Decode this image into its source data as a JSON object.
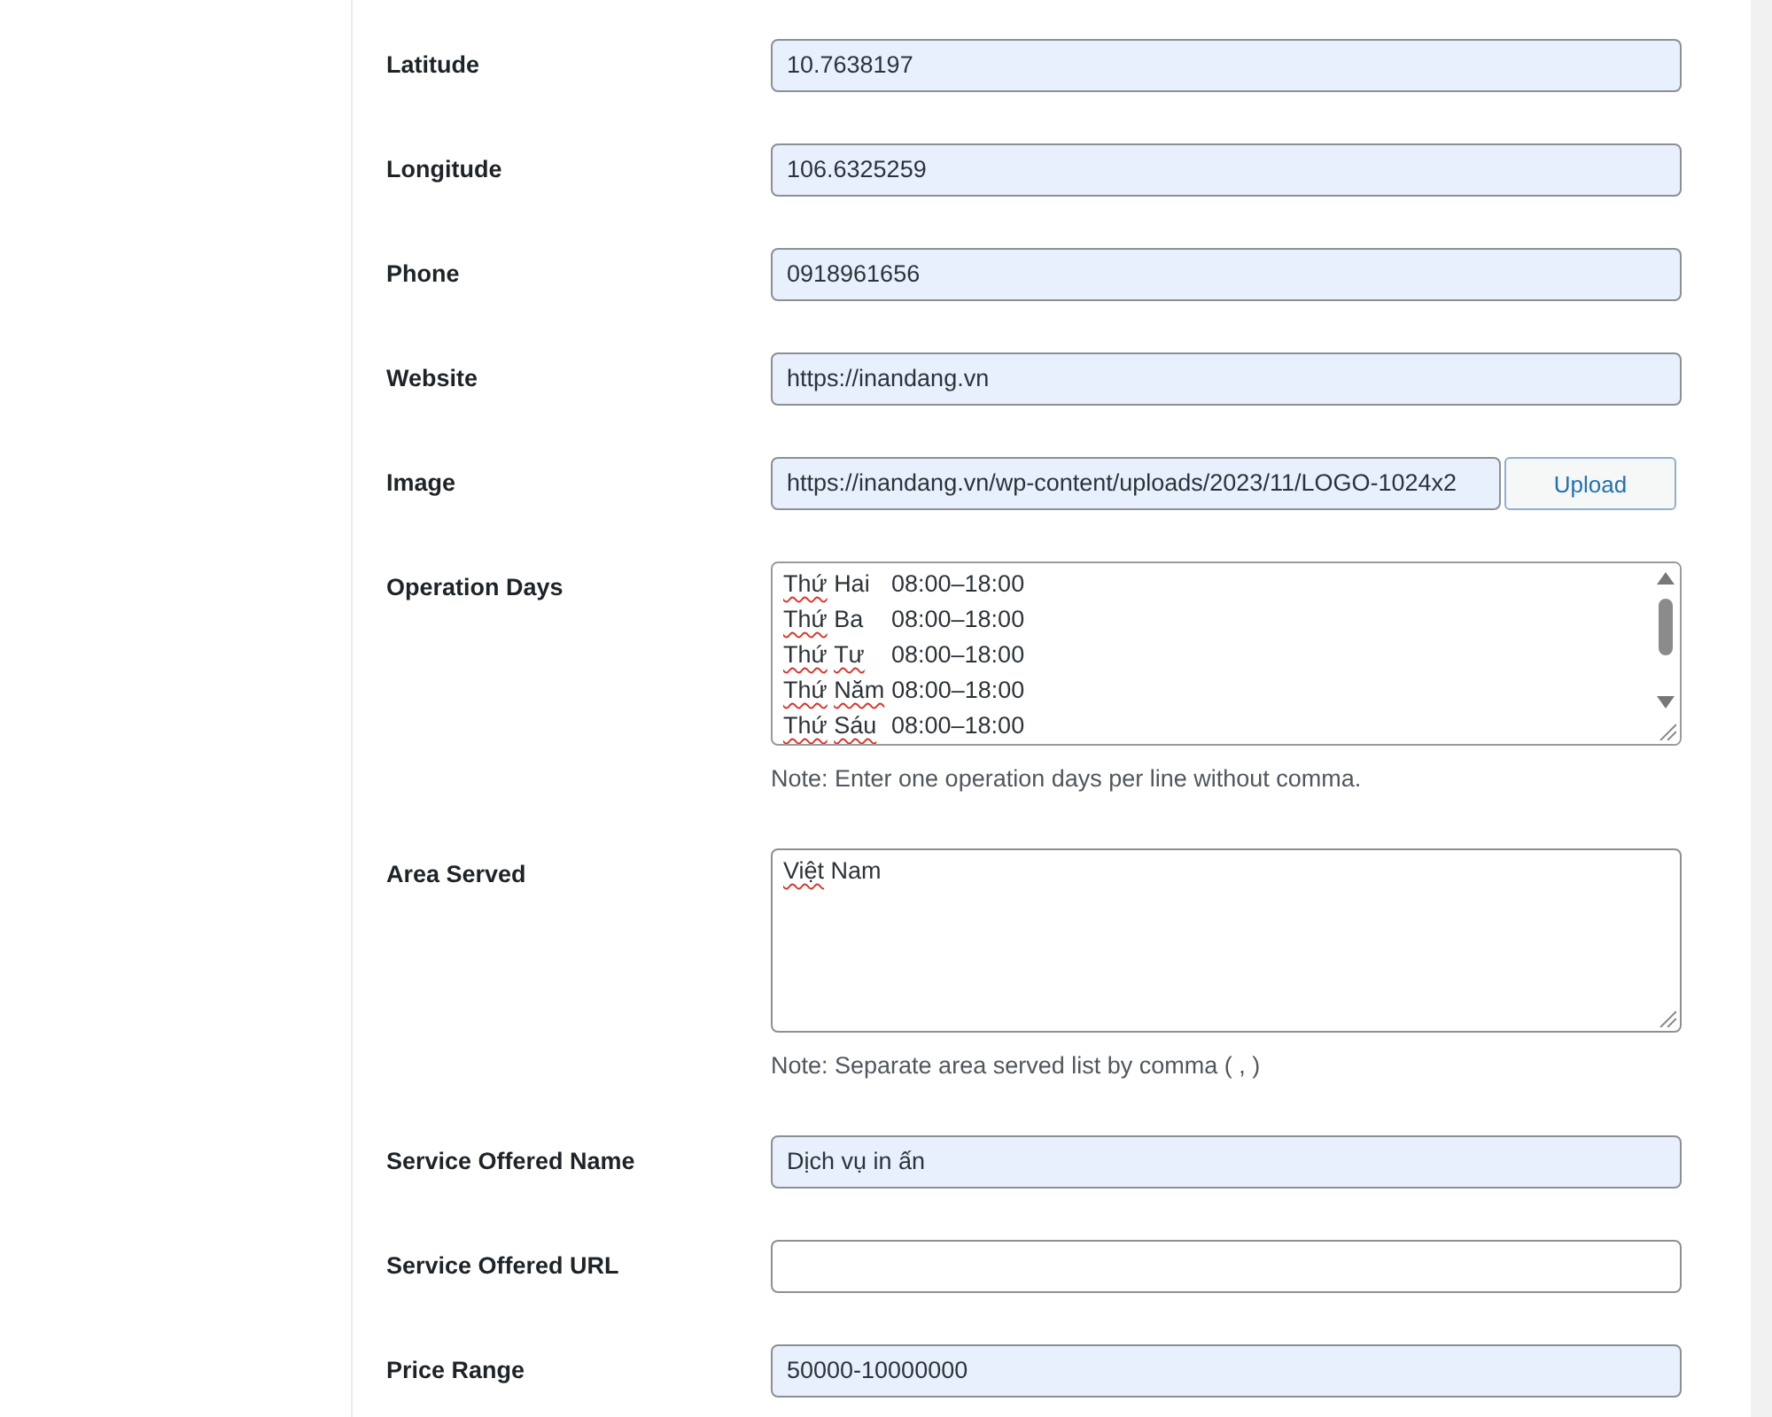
{
  "form": {
    "fields": [
      {
        "kind": "text",
        "label": "Latitude",
        "value": "10.7638197",
        "autofilled": true
      },
      {
        "kind": "text",
        "label": "Longitude",
        "value": "106.6325259",
        "autofilled": true
      },
      {
        "kind": "text",
        "label": "Phone",
        "value": "0918961656",
        "autofilled": true
      },
      {
        "kind": "text",
        "label": "Website",
        "value": "https://inandang.vn",
        "autofilled": true
      },
      {
        "kind": "upload",
        "label": "Image",
        "value": "https://inandang.vn/wp-content/uploads/2023/11/LOGO-1024x2",
        "autofilled": true,
        "button": "Upload"
      },
      {
        "kind": "textarea",
        "label": "Operation Days",
        "autofilled": false,
        "scrollbar": true,
        "lines": [
          {
            "words": [
              {
                "word": "Thứ",
                "misspelled": true
              },
              {
                "word": "Hai",
                "misspelled": false
              }
            ],
            "hours": "08:00–18:00"
          },
          {
            "words": [
              {
                "word": "Thứ",
                "misspelled": true
              },
              {
                "word": "Ba",
                "misspelled": false
              }
            ],
            "hours": "08:00–18:00"
          },
          {
            "words": [
              {
                "word": "Thứ",
                "misspelled": true
              },
              {
                "word": "Tư",
                "misspelled": true
              }
            ],
            "hours": "08:00–18:00"
          },
          {
            "words": [
              {
                "word": "Thứ",
                "misspelled": true
              },
              {
                "word": "Năm",
                "misspelled": true
              }
            ],
            "hours": "08:00–18:00"
          },
          {
            "words": [
              {
                "word": "Thứ",
                "misspelled": true
              },
              {
                "word": "Sáu",
                "misspelled": true
              }
            ],
            "hours": "08:00–18:00"
          }
        ],
        "note": "Note: Enter one operation days per line without comma."
      },
      {
        "kind": "textarea",
        "label": "Area Served",
        "autofilled": false,
        "scrollbar": false,
        "lines": [
          {
            "words": [
              {
                "word": "Việt",
                "misspelled": true
              },
              {
                "word": "Nam",
                "misspelled": false
              }
            ]
          }
        ],
        "note": "Note: Separate area served list by comma ( , )"
      },
      {
        "kind": "text",
        "label": "Service Offered Name",
        "value": "Dịch vụ in ấn",
        "autofilled": true
      },
      {
        "kind": "text",
        "label": "Service Offered URL",
        "autofilled": false
      },
      {
        "kind": "text",
        "label": "Price Range",
        "value": "50000-10000000",
        "autofilled": true
      }
    ]
  }
}
